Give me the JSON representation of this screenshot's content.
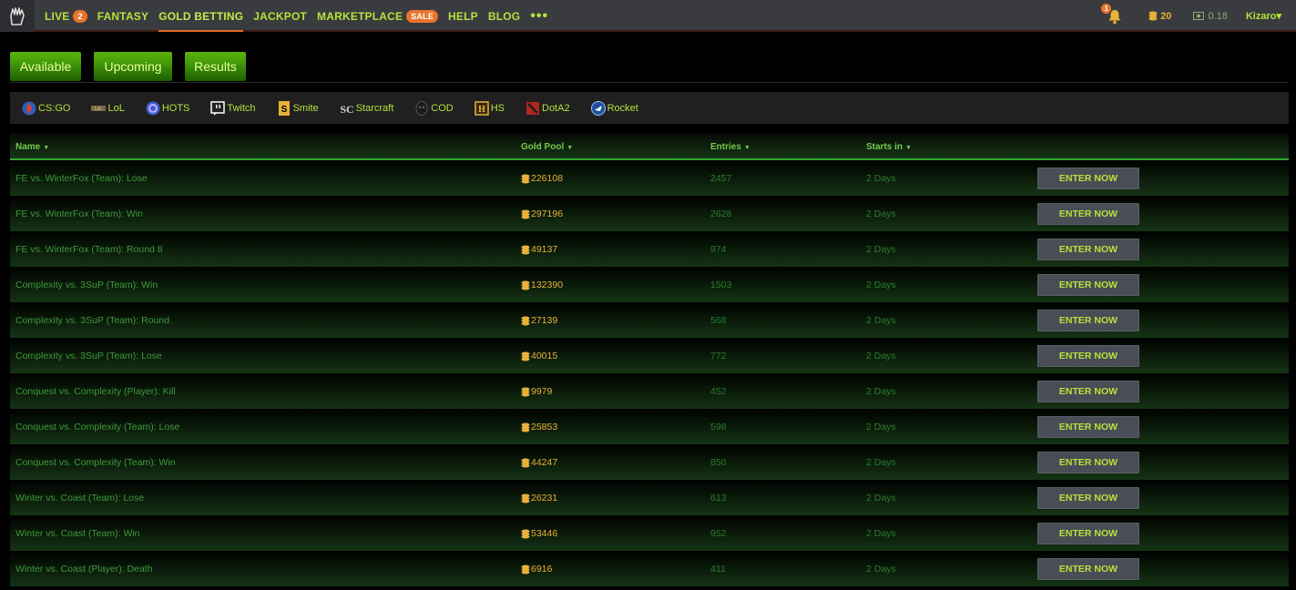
{
  "nav": {
    "items": [
      {
        "label": "LIVE",
        "badge": "2"
      },
      {
        "label": "FANTASY"
      },
      {
        "label": "GOLD BETTING",
        "active": true
      },
      {
        "label": "JACKPOT"
      },
      {
        "label": "MARKETPLACE",
        "badge": "SALE"
      },
      {
        "label": "HELP"
      },
      {
        "label": "BLOG"
      }
    ],
    "more": "•••",
    "notifications": "1",
    "gold": "20",
    "cash": "0.18",
    "user": "Kizaro▾"
  },
  "tabs": [
    "Available",
    "Upcoming",
    "Results"
  ],
  "games": [
    {
      "label": "CS:GO",
      "icon": "csgo-icon"
    },
    {
      "label": "LoL",
      "icon": "lol-icon"
    },
    {
      "label": "HOTS",
      "icon": "hots-icon"
    },
    {
      "label": "Twitch",
      "icon": "twitch-icon"
    },
    {
      "label": "Smite",
      "icon": "smite-icon"
    },
    {
      "label": "Starcraft",
      "icon": "starcraft-icon"
    },
    {
      "label": "COD",
      "icon": "cod-icon"
    },
    {
      "label": "HS",
      "icon": "hearthstone-icon"
    },
    {
      "label": "DotA2",
      "icon": "dota2-icon"
    },
    {
      "label": "Rocket",
      "icon": "rocket-league-icon"
    }
  ],
  "table": {
    "headers": {
      "name": "Name",
      "pool": "Gold Pool",
      "entries": "Entries",
      "starts": "Starts in"
    },
    "button_label": "ENTER NOW",
    "rows": [
      {
        "name": "FE vs. WinterFox (Team): Lose",
        "pool": "226108",
        "entries": "2457",
        "starts": "2 Days"
      },
      {
        "name": "FE vs. WinterFox (Team): Win",
        "pool": "297196",
        "entries": "2628",
        "starts": "2 Days"
      },
      {
        "name": "FE vs. WinterFox (Team): Round 8",
        "pool": "49137",
        "entries": "974",
        "starts": "2 Days"
      },
      {
        "name": "Complexity vs. 3SuP (Team): Win",
        "pool": "132390",
        "entries": "1503",
        "starts": "2 Days"
      },
      {
        "name": "Complexity vs. 3SuP (Team): Round",
        "pool": "27139",
        "entries": "568",
        "starts": "2 Days"
      },
      {
        "name": "Complexity vs. 3SuP (Team): Lose",
        "pool": "40015",
        "entries": "772",
        "starts": "2 Days"
      },
      {
        "name": "Conquest vs. Complexity (Player): Kill",
        "pool": "9979",
        "entries": "452",
        "starts": "2 Days"
      },
      {
        "name": "Conquest vs. Complexity (Team): Lose",
        "pool": "25853",
        "entries": "598",
        "starts": "2 Days"
      },
      {
        "name": "Conquest vs. Complexity (Team): Win",
        "pool": "44247",
        "entries": "850",
        "starts": "2 Days"
      },
      {
        "name": "Winter vs. Coast (Team): Lose",
        "pool": "26231",
        "entries": "613",
        "starts": "2 Days"
      },
      {
        "name": "Winter vs. Coast (Team): Win",
        "pool": "53446",
        "entries": "952",
        "starts": "2 Days"
      },
      {
        "name": "Winter vs. Coast (Player): Death",
        "pool": "6916",
        "entries": "411",
        "starts": "2 Days"
      }
    ]
  },
  "colors": {
    "accent": "#b6e23b",
    "gold": "#e8b23a",
    "orange": "#e8742e",
    "green_row": "#3f9a3a"
  }
}
